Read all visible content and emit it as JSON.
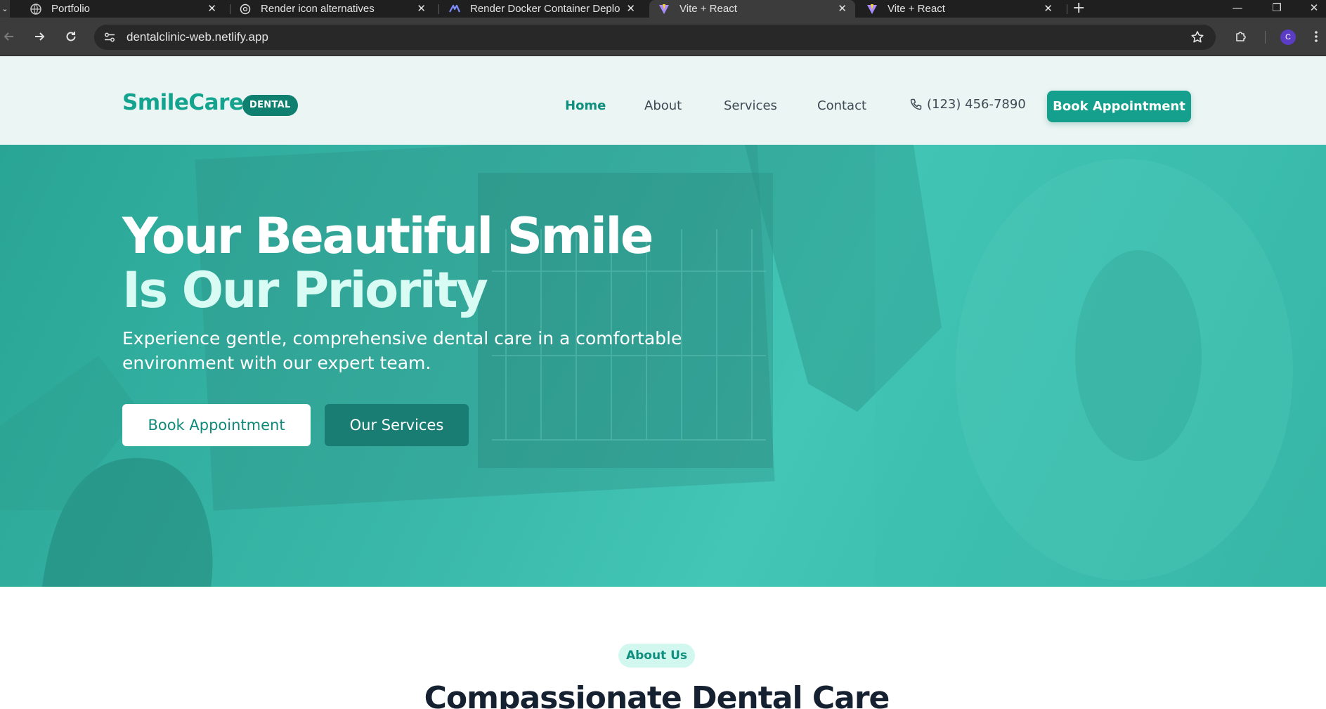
{
  "browser": {
    "tabs": [
      {
        "title": "Portfolio",
        "icon": "globe-icon",
        "active": false
      },
      {
        "title": "Render icon alternatives",
        "icon": "chatgpt-icon",
        "active": false
      },
      {
        "title": "Render Docker Container Deplo",
        "icon": "claude-icon",
        "active": false
      },
      {
        "title": "Vite + React",
        "icon": "vite-icon",
        "active": true
      },
      {
        "title": "Vite + React",
        "icon": "vite-icon",
        "active": false
      }
    ],
    "close_glyph": "✕",
    "new_tab_glyph": "+",
    "url": "dentalclinic-web.netlify.app",
    "profile_initial": "C",
    "window_controls": {
      "minimize": "—",
      "restore": "❐",
      "close": "✕"
    }
  },
  "site": {
    "logo": "SmileCare",
    "logo_badge": "DENTAL",
    "nav": [
      {
        "label": "Home",
        "active": true
      },
      {
        "label": "About",
        "active": false
      },
      {
        "label": "Services",
        "active": false
      },
      {
        "label": "Contact",
        "active": false
      }
    ],
    "phone": "(123) 456-7890",
    "header_cta": "Book Appointment",
    "colors": {
      "primary": "#14a08c",
      "dark": "#0f7f70",
      "hero_light_text": "#d8fbf3"
    }
  },
  "hero": {
    "headline_line1": "Your Beautiful Smile",
    "headline_line2": "Is Our Priority",
    "subtitle": "Experience gentle, comprehensive dental care in a comfortable environment with our expert team.",
    "primary_button": "Book Appointment",
    "secondary_button": "Our Services"
  },
  "about": {
    "pill": "About Us",
    "title": "Compassionate Dental Care"
  }
}
